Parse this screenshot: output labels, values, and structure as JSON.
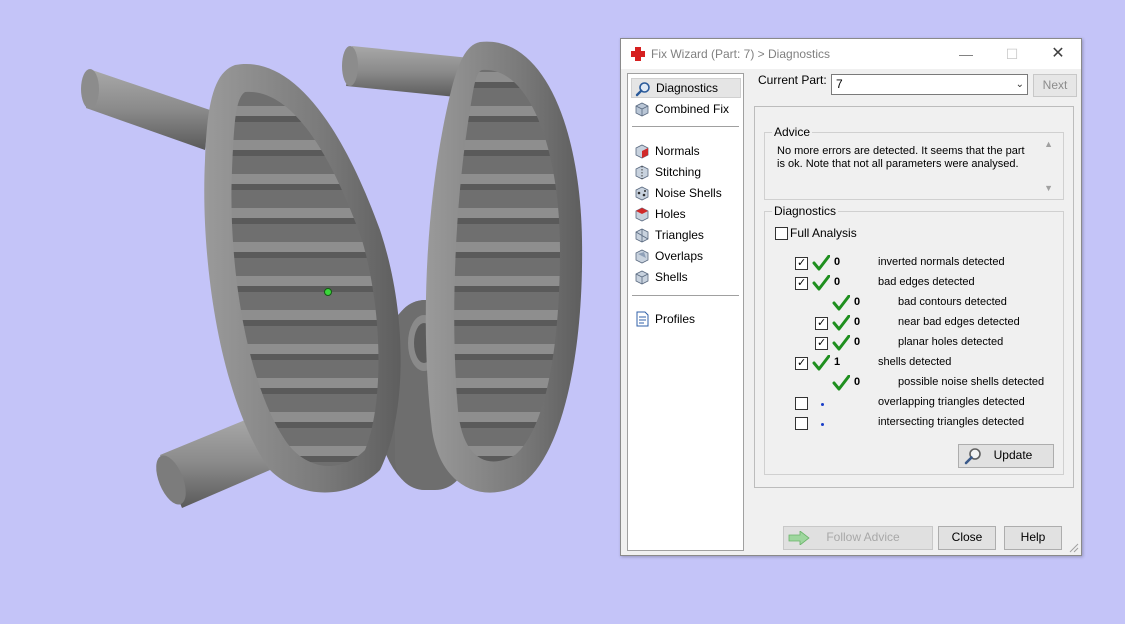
{
  "dialog": {
    "title": "Fix Wizard (Part: 7) > Diagnostics",
    "window_controls": {
      "minimize": "—",
      "maximize": "☐",
      "close": "✕"
    }
  },
  "nav": {
    "items": [
      {
        "label": "Diagnostics",
        "icon": "magnifier-icon",
        "active": true
      },
      {
        "label": "Combined Fix",
        "icon": "combined-fix-icon"
      },
      {
        "label": "Normals",
        "icon": "normals-cube-icon"
      },
      {
        "label": "Stitching",
        "icon": "stitching-cube-icon"
      },
      {
        "label": "Noise Shells",
        "icon": "noise-shells-cube-icon"
      },
      {
        "label": "Holes",
        "icon": "holes-cube-icon"
      },
      {
        "label": "Triangles",
        "icon": "triangles-cube-icon"
      },
      {
        "label": "Overlaps",
        "icon": "overlaps-cube-icon"
      },
      {
        "label": "Shells",
        "icon": "shells-cube-icon"
      },
      {
        "label": "Profiles",
        "icon": "profiles-document-icon"
      }
    ]
  },
  "current_part": {
    "label": "Current Part:",
    "value": "7"
  },
  "next_button": "Next",
  "advice": {
    "legend": "Advice",
    "text": "No more errors are detected. It seems that the part\nis ok. Note that not all parameters were analysed."
  },
  "diagnostics": {
    "legend": "Diagnostics",
    "full_analysis": {
      "label": "Full Analysis",
      "checked": false
    },
    "rows": [
      {
        "checkbox": true,
        "checked": true,
        "status": "ok",
        "count": "0",
        "label": "inverted normals detected",
        "indent": 0
      },
      {
        "checkbox": true,
        "checked": true,
        "status": "ok",
        "count": "0",
        "label": "bad edges detected",
        "indent": 0
      },
      {
        "checkbox": false,
        "status": "ok",
        "count": "0",
        "label": "bad contours detected",
        "indent": 1
      },
      {
        "checkbox": true,
        "checked": true,
        "status": "ok",
        "count": "0",
        "label": "near bad edges detected",
        "indent": 1
      },
      {
        "checkbox": true,
        "checked": true,
        "status": "ok",
        "count": "0",
        "label": "planar holes detected",
        "indent": 1
      },
      {
        "checkbox": true,
        "checked": true,
        "status": "ok",
        "count": "1",
        "label": "shells detected",
        "indent": 0
      },
      {
        "checkbox": false,
        "status": "ok",
        "count": "0",
        "label": "possible noise shells detected",
        "indent": 1
      },
      {
        "checkbox": true,
        "checked": false,
        "status": "none",
        "count": "",
        "label": "overlapping triangles detected",
        "indent": 0
      },
      {
        "checkbox": true,
        "checked": false,
        "status": "none",
        "count": "",
        "label": "intersecting triangles detected",
        "indent": 0
      }
    ],
    "update_button": "Update"
  },
  "footer": {
    "follow_advice": "Follow Advice",
    "close": "Close",
    "help": "Help"
  },
  "colors": {
    "viewport_background": "#c4c4f8",
    "check_green": "#1f8f1f",
    "model_gray": "#7d7d7d"
  }
}
